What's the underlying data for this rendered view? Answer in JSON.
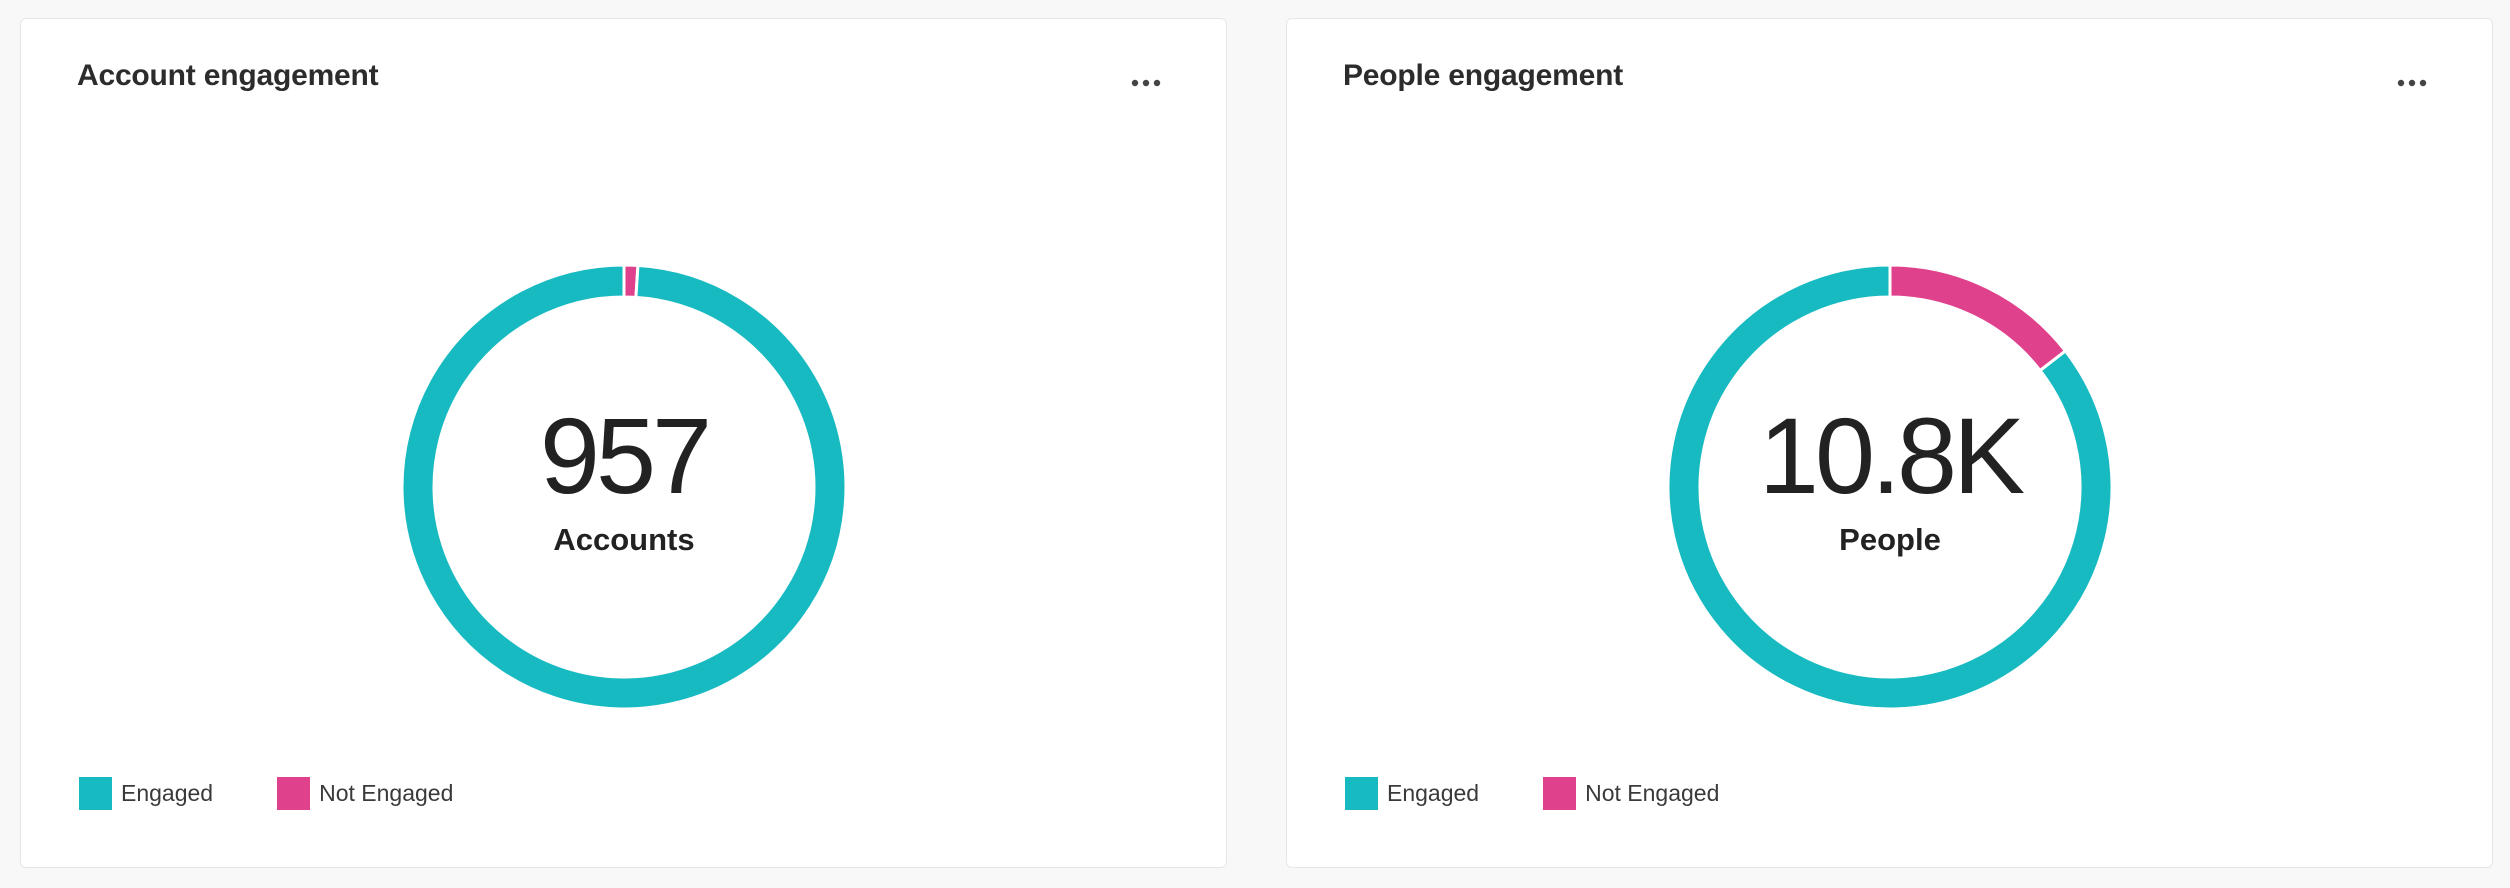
{
  "colors": {
    "engaged": "#18bac1",
    "not_engaged": "#e0418c"
  },
  "cards": [
    {
      "title": "Account engagement",
      "menu_icon": "more-horizontal-icon",
      "center_value": "957",
      "center_label": "Accounts",
      "legend": [
        {
          "label": "Engaged",
          "color": "#18bac1"
        },
        {
          "label": "Not Engaged",
          "color": "#e0418c"
        }
      ]
    },
    {
      "title": "People engagement",
      "menu_icon": "more-horizontal-icon",
      "center_value": "10.8K",
      "center_label": "People",
      "legend": [
        {
          "label": "Engaged",
          "color": "#18bac1"
        },
        {
          "label": "Not Engaged",
          "color": "#e0418c"
        }
      ]
    }
  ],
  "chart_data": [
    {
      "type": "pie",
      "title": "Account engagement",
      "categories": [
        "Engaged",
        "Not Engaged"
      ],
      "values": [
        0.99,
        0.01
      ],
      "legend_position": "bottom-left"
    },
    {
      "type": "pie",
      "title": "People engagement",
      "categories": [
        "Engaged",
        "Not Engaged"
      ],
      "values": [
        0.855,
        0.145
      ],
      "legend_position": "bottom-left"
    }
  ]
}
